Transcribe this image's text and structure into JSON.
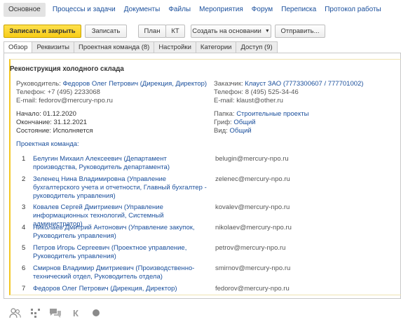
{
  "nav": {
    "items": [
      "Основное",
      "Процессы и задачи",
      "Документы",
      "Файлы",
      "Мероприятия",
      "Форум",
      "Переписка",
      "Протокол работы"
    ]
  },
  "toolbar": {
    "save_close": "Записать и закрыть",
    "save": "Записать",
    "plan": "План",
    "kt": "КТ",
    "create_based": "Создать на основании",
    "send": "Отправить..."
  },
  "tabs": [
    "Обзор",
    "Реквизиты",
    "Проектная команда (8)",
    "Настройки",
    "Категории",
    "Доступ (9)"
  ],
  "project": {
    "title": "Реконструкция холодного склада",
    "manager_label": "Руководитель:",
    "manager": "Федоров Олег Петрович (Дирекция, Директор)",
    "manager_phone": "Телефон: +7 (495) 2233068",
    "manager_email": "E-mail: fedorov@mercury-npo.ru",
    "customer_label": "Заказчик:",
    "customer": "Клауст ЗАО (7773300607 / 777701002)",
    "customer_phone": "Телефон: 8 (495) 525-34-46",
    "customer_email": "E-mail: klaust@other.ru",
    "start": "Начало: 01.12.2020",
    "end": "Окончание: 31.12.2021",
    "state": "Состояние: Исполняется",
    "folder_label": "Папка:",
    "folder": "Строительные проекты",
    "stamp_label": "Гриф:",
    "stamp": "Общий",
    "type_label": "Вид:",
    "type": "Общий"
  },
  "team": {
    "label": "Проектная команда:",
    "members": [
      {
        "num": "1",
        "name": "Белугин Михаил Алексеевич (Департамент производства, Руководитель департамента)",
        "email": "belugin@mercury-npo.ru"
      },
      {
        "num": "2",
        "name": "Зеленец Нина Владимировна (Управление бухгалтерского учета и отчетности, Главный бухгалтер - руководитель управления)",
        "email": "zelenec@mercury-npo.ru"
      },
      {
        "num": "3",
        "name": "Ковалев Сергей Дмитриевич (Управление информационных технологий, Системный администратор)",
        "email": "kovalev@mercury-npo.ru"
      },
      {
        "num": "4",
        "name": "Николаев Дмитрий Антонович (Управление закупок, Руководитель управления)",
        "email": "nikolaev@mercury-npo.ru"
      },
      {
        "num": "5",
        "name": "Петров Игорь Сергеевич (Проектное управление, Руководитель управления)",
        "email": "petrov@mercury-npo.ru"
      },
      {
        "num": "6",
        "name": "Смирнов Владимир Дмитриевич (Производственно-технический отдел, Руководитель отдела)",
        "email": "smirnov@mercury-npo.ru"
      },
      {
        "num": "7",
        "name": "Федоров Олег Петрович (Дирекция, Директор)",
        "email": "fedorov@mercury-npo.ru"
      }
    ]
  },
  "bottom_icons": [
    "people-icon",
    "tree-icon",
    "chat-icon",
    "k-icon",
    "dot-icon"
  ],
  "bottom_k_glyph": "К",
  "colors": {
    "link": "#1a4f9c",
    "accent": "#f7cc17"
  }
}
